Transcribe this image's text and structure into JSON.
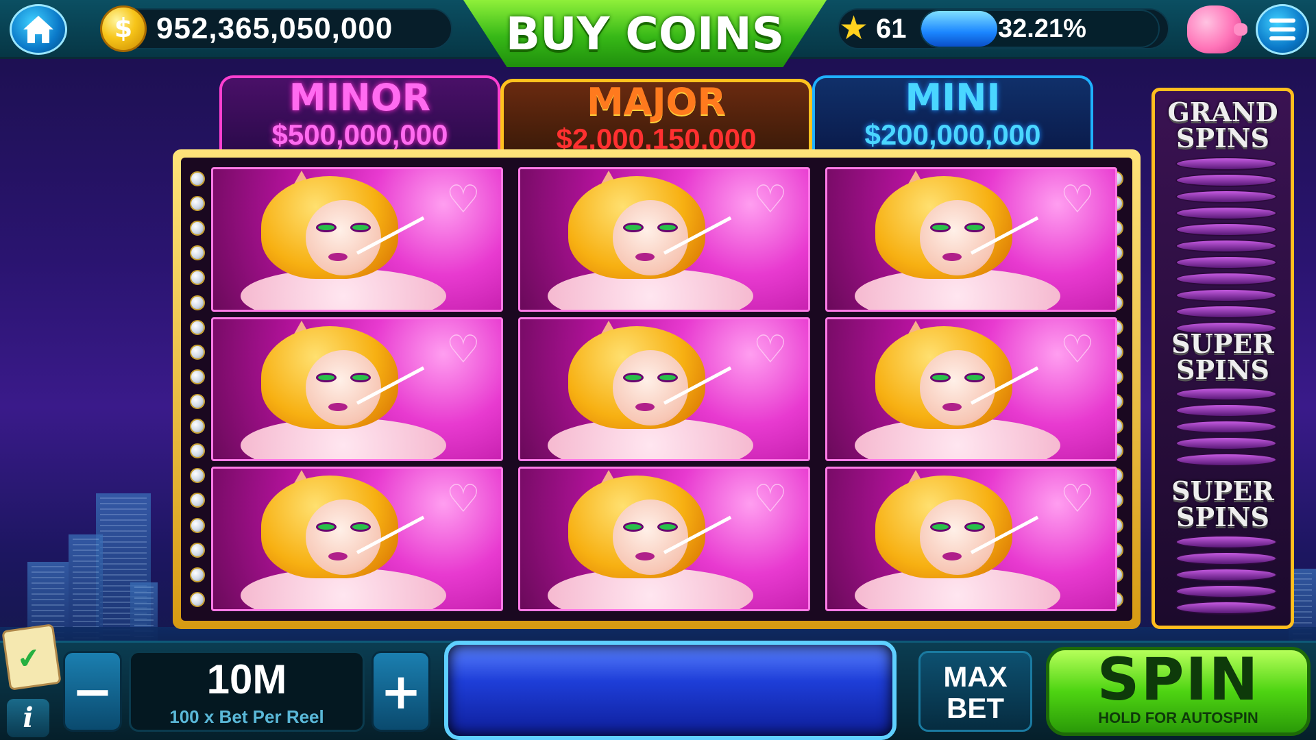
{
  "topbar": {
    "balance": "952,365,050,000",
    "buy_coins_label": "BUY COINS",
    "level": "61",
    "xp_percent_text": "32.21%",
    "xp_fraction": 0.32
  },
  "jackpots": {
    "minor": {
      "name": "MINOR",
      "value": "$500,000,000"
    },
    "major": {
      "name": "MAJOR",
      "value": "$2,000,150,000"
    },
    "mini": {
      "name": "MINI",
      "value": "$200,000,000"
    }
  },
  "reels": {
    "columns": 3,
    "rows": 3,
    "symbol": "cat-lady-symbol"
  },
  "side_panel": {
    "grand_label": "GRAND SPINS",
    "super_label_1": "SUPER SPINS",
    "super_label_2": "SUPER SPINS"
  },
  "bottombar": {
    "bet_value": "10M",
    "bet_subtitle": "100 x Bet Per Reel",
    "max_bet_label": "MAX BET",
    "spin_label": "SPIN",
    "spin_subtitle": "HOLD FOR AUTOSPIN",
    "minus_label": "−",
    "plus_label": "+",
    "info_label": "i"
  },
  "icons": {
    "home": "home-icon",
    "coin": "coin-icon",
    "star": "star-icon",
    "piggy": "piggy-bank-icon",
    "menu": "menu-icon",
    "clipboard": "clipboard-check-icon",
    "info": "info-icon"
  }
}
